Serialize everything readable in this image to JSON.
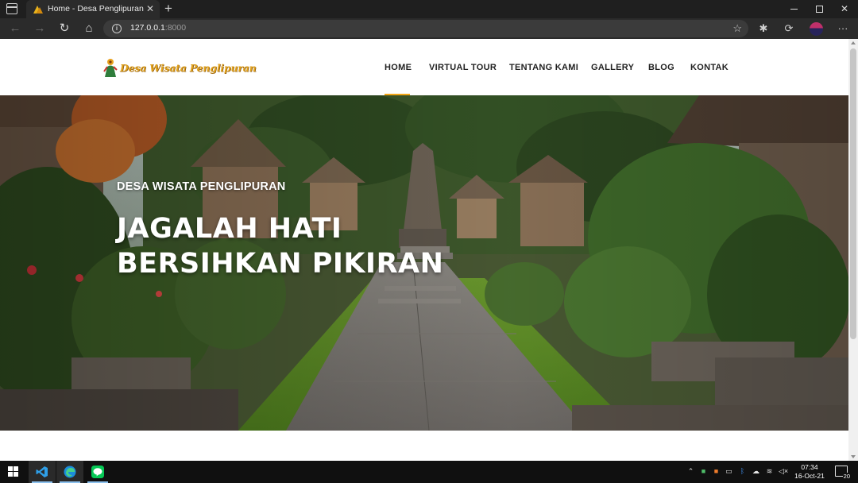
{
  "browser": {
    "tab_title": "Home - Desa Penglipuran",
    "url_host": "127.0.0.1",
    "url_port": ":8000"
  },
  "site": {
    "logo_text": "Desa Wisata Penglipuran",
    "menu": [
      {
        "label": "HOME",
        "active": true
      },
      {
        "label": "VIRTUAL TOUR",
        "active": false
      },
      {
        "label": "TENTANG KAMI",
        "active": false
      },
      {
        "label": "GALLERY",
        "active": false
      },
      {
        "label": "BLOG",
        "active": false
      },
      {
        "label": "KONTAK",
        "active": false
      }
    ],
    "accent_color": "#f2a516"
  },
  "hero": {
    "subtitle": "DESA WISATA PENGLIPURAN",
    "title_line1": "JAGALAH HATI",
    "title_line2": "BERSIHKAN PIKIRAN"
  },
  "taskbar": {
    "time": "07:34",
    "date": "16-Oct-21",
    "notification_count": "20",
    "apps": [
      "vscode-icon",
      "edge-icon",
      "line-icon"
    ]
  }
}
